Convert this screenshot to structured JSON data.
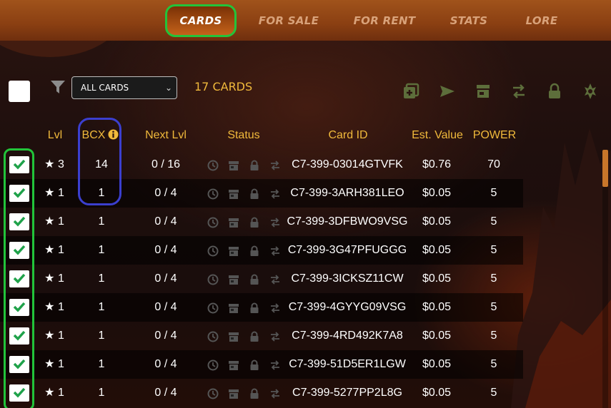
{
  "nav": {
    "tabs": [
      {
        "label": "CARDS",
        "active": true
      },
      {
        "label": "FOR SALE",
        "active": false
      },
      {
        "label": "FOR RENT",
        "active": false
      },
      {
        "label": "STATS",
        "active": false
      },
      {
        "label": "LORE",
        "active": false
      }
    ]
  },
  "toolbar": {
    "filter_selected": "ALL CARDS",
    "card_count": "17 CARDS",
    "actions": [
      "combine-icon",
      "send-icon",
      "market-icon",
      "transfer-icon",
      "lock-icon",
      "burn-icon"
    ]
  },
  "table": {
    "headers": {
      "lvl": "Lvl",
      "bcx": "BCX",
      "next_lvl": "Next Lvl",
      "status": "Status",
      "card_id": "Card ID",
      "est_value": "Est. Value",
      "power": "POWER"
    },
    "rows": [
      {
        "lvl": "★ 3",
        "bcx": "14",
        "next_lvl": "0 / 16",
        "card_id": "C7-399-03014GTVFK",
        "est_value": "$0.76",
        "power": "70",
        "checked": true
      },
      {
        "lvl": "★ 1",
        "bcx": "1",
        "next_lvl": "0 / 4",
        "card_id": "C7-399-3ARH381LEO",
        "est_value": "$0.05",
        "power": "5",
        "checked": true
      },
      {
        "lvl": "★ 1",
        "bcx": "1",
        "next_lvl": "0 / 4",
        "card_id": "C7-399-3DFBWO9VSG",
        "est_value": "$0.05",
        "power": "5",
        "checked": true
      },
      {
        "lvl": "★ 1",
        "bcx": "1",
        "next_lvl": "0 / 4",
        "card_id": "C7-399-3G47PFUGGG",
        "est_value": "$0.05",
        "power": "5",
        "checked": true
      },
      {
        "lvl": "★ 1",
        "bcx": "1",
        "next_lvl": "0 / 4",
        "card_id": "C7-399-3ICKSZ11CW",
        "est_value": "$0.05",
        "power": "5",
        "checked": true
      },
      {
        "lvl": "★ 1",
        "bcx": "1",
        "next_lvl": "0 / 4",
        "card_id": "C7-399-4GYYG09VSG",
        "est_value": "$0.05",
        "power": "5",
        "checked": true
      },
      {
        "lvl": "★ 1",
        "bcx": "1",
        "next_lvl": "0 / 4",
        "card_id": "C7-399-4RD492K7A8",
        "est_value": "$0.05",
        "power": "5",
        "checked": true
      },
      {
        "lvl": "★ 1",
        "bcx": "1",
        "next_lvl": "0 / 4",
        "card_id": "C7-399-51D5ER1LGW",
        "est_value": "$0.05",
        "power": "5",
        "checked": true
      },
      {
        "lvl": "★ 1",
        "bcx": "1",
        "next_lvl": "0 / 4",
        "card_id": "C7-399-5277PP2L8G",
        "est_value": "$0.05",
        "power": "5",
        "checked": true
      }
    ]
  },
  "colors": {
    "accent_gold": "#f0b93b",
    "nav_bg": "#8a3f12",
    "highlight_green": "#22c43a",
    "highlight_blue": "#3b3fcf",
    "check_green": "#1fa24a"
  }
}
